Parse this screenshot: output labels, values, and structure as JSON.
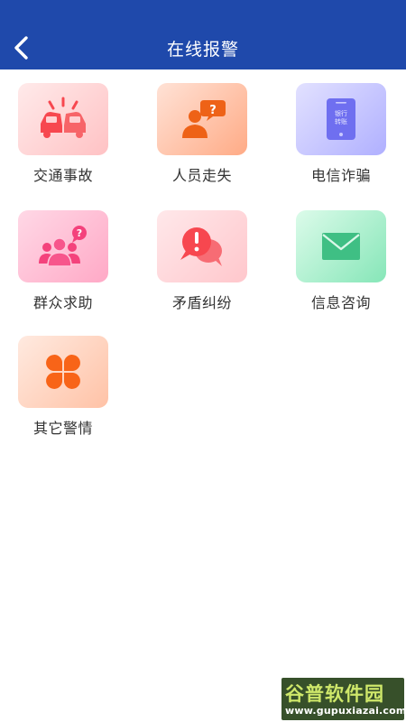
{
  "header": {
    "title": "在线报警",
    "back_icon": "chevron-left-icon",
    "background": "#1f49ab"
  },
  "tiles": [
    {
      "label": "交通事故",
      "icon": "car-crash-icon"
    },
    {
      "label": "人员走失",
      "icon": "missing-person-icon"
    },
    {
      "label": "电信诈骗",
      "icon": "phone-fraud-icon",
      "icon_text_1": "银行",
      "icon_text_2": "转账"
    },
    {
      "label": "群众求助",
      "icon": "group-help-icon"
    },
    {
      "label": "矛盾纠纷",
      "icon": "dispute-bubbles-icon"
    },
    {
      "label": "信息咨询",
      "icon": "envelope-icon"
    },
    {
      "label": "其它警情",
      "icon": "clover-icon"
    }
  ],
  "watermark": {
    "brand": "谷普软件园",
    "url": "www.gupuxiazai.com"
  }
}
